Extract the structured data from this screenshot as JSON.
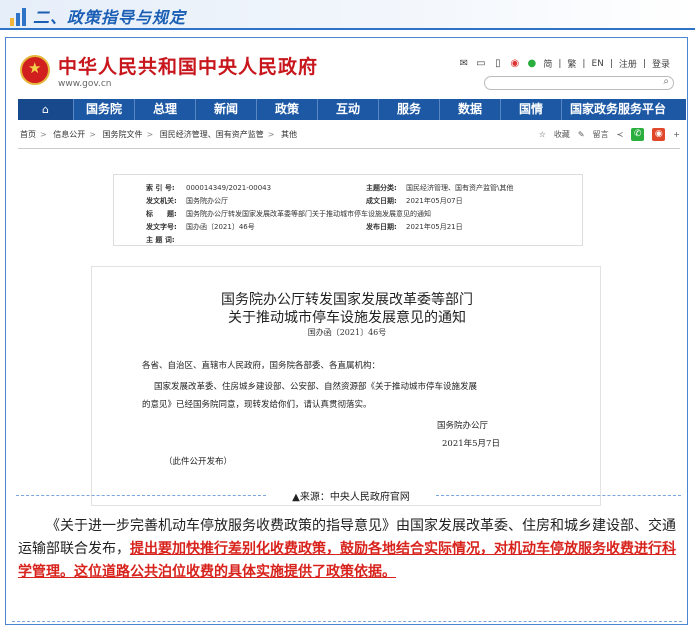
{
  "section": {
    "title": "二、政策指导与规定"
  },
  "header": {
    "site_title": "中华人民共和国中央人民政府",
    "site_url": "www.gov.cn",
    "top_links": [
      "简",
      "繁",
      "EN",
      "注册",
      "登录"
    ]
  },
  "nav": {
    "logo": "国务院",
    "items": [
      "国务院",
      "总理",
      "新闻",
      "政策",
      "互动",
      "服务",
      "数据",
      "国情",
      "国家政务服务平台"
    ]
  },
  "breadcrumb": {
    "items": [
      "首页",
      "信息公开",
      "国务院文件",
      "国民经济管理、国有资产监管",
      "其他"
    ],
    "actions": {
      "favorite": "收藏",
      "print": "留言"
    }
  },
  "meta": {
    "index_label": "索 引 号:",
    "index_value": "000014349/2021-00043",
    "topic_label": "主题分类:",
    "topic_value": "国民经济管理、国有资产监管\\其他",
    "issuer_label": "发文机关:",
    "issuer_value": "国务院办公厅",
    "date_label": "成文日期:",
    "date_value": "2021年05月07日",
    "title_label": "标　　题:",
    "title_value": "国务院办公厅转发国家发展改革委等部门关于推动城市停车设施发展意见的通知",
    "docno_label": "发文字号:",
    "docno_value": "国办函〔2021〕46号",
    "pubdate_label": "发布日期:",
    "pubdate_value": "2021年05月21日",
    "subject_label": "主 题 词:"
  },
  "document": {
    "title_line1": "国务院办公厅转发国家发展改革委等部门",
    "title_line2": "关于推动城市停车设施发展意见的通知",
    "number": "国办函〔2021〕46号",
    "line1": "各省、自治区、直辖市人民政府，国务院各部委、各直属机构：",
    "line2": "国家发展改革委、住房城乡建设部、公安部、自然资源部《关于推动城市停车设施发展",
    "line3": "的意见》已经国务院同意，现转发给你们，请认真贯彻落实。",
    "signer": "国务院办公厅",
    "date": "2021年5月7日",
    "note": "（此件公开发布）"
  },
  "source": {
    "text": "▲来源：中央人民政府官网"
  },
  "paragraph": {
    "normal": "《关于进一步完善机动车停放服务收费政策的指导意见》由国家发展改革委、住房和城乡建设部、交通运输部联合发布，",
    "highlight": "提出要加快推行差别化收费政策，鼓励各地结合实际情况，对机动车停放服务收费进行科学管理。这位道路公共泊位收费的具体实施提供了政策依据。"
  },
  "colors": {
    "accent": "#1d58a5",
    "red": "#c8161d",
    "highlight": "#d8231d"
  }
}
